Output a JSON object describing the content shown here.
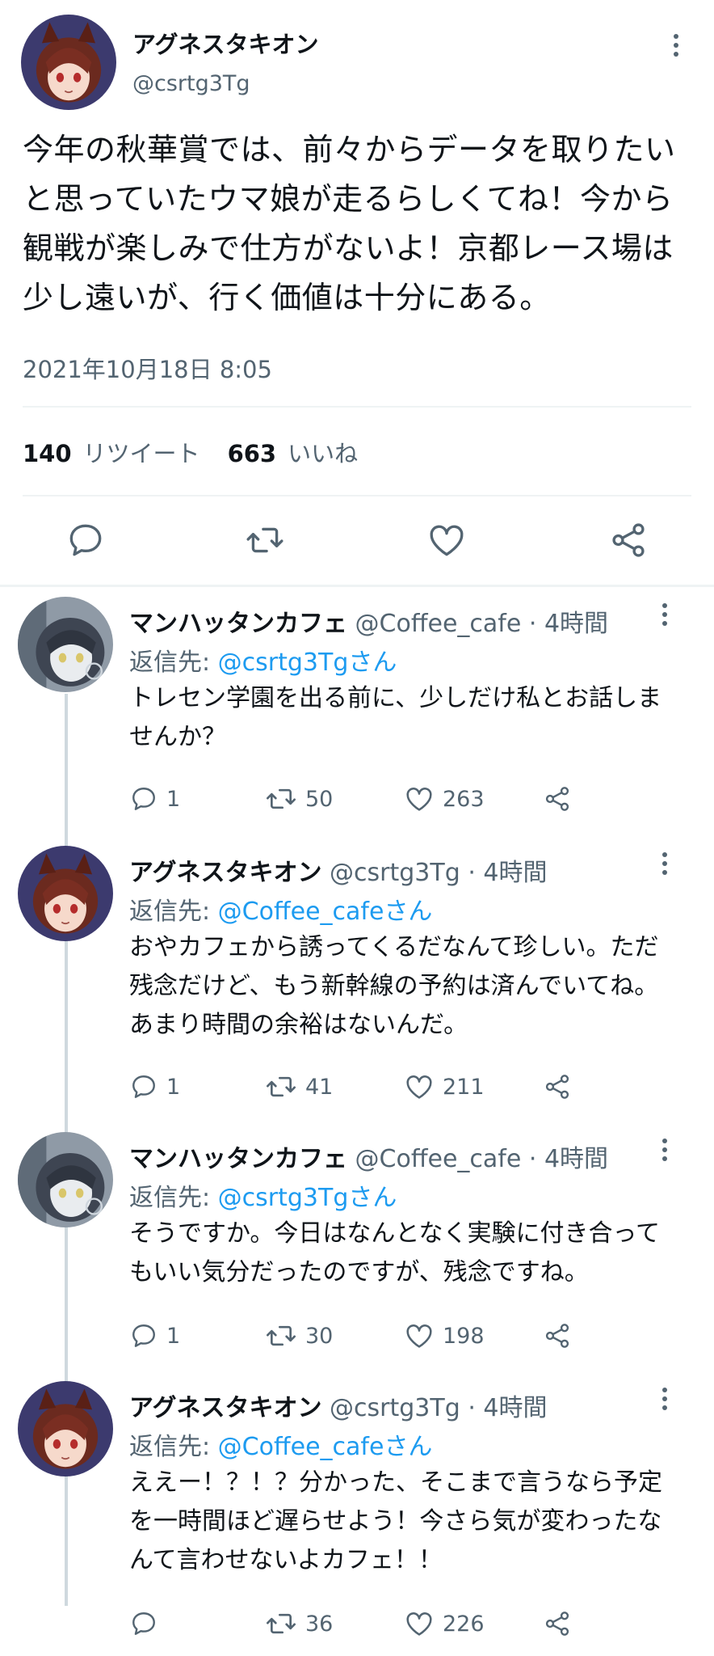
{
  "main_tweet": {
    "author_name": "アグネスタキオン",
    "author_handle": "@csrtg3Tg",
    "text": "今年の秋華賞では、前々からデータを取りたいと思っていたウマ娘が走るらしくてね！今から観戦が楽しみで仕方がないよ！京都レース場は少し遠いが、行く価値は十分にある。",
    "timestamp": "2021年10月18日 8:05",
    "retweet_count": "140",
    "retweet_label": "リツイート",
    "like_count": "663",
    "like_label": "いいね"
  },
  "replies": [
    {
      "name": "マンハッタンカフェ",
      "handle": "@Coffee_cafe",
      "separator": "·",
      "time": "4時間",
      "replying_to_label": "返信先:",
      "replying_to": "@csrtg3Tgさん",
      "text": "トレセン学園を出る前に、少しだけ私とお話しませんか？",
      "reply_count": "1",
      "retweet_count": "50",
      "like_count": "263"
    },
    {
      "name": "アグネスタキオン",
      "handle": "@csrtg3Tg",
      "separator": "·",
      "time": "4時間",
      "replying_to_label": "返信先:",
      "replying_to": "@Coffee_cafeさん",
      "text": "おやカフェから誘ってくるだなんて珍しい。ただ残念だけど、もう新幹線の予約は済んでいてね。あまり時間の余裕はないんだ。",
      "reply_count": "1",
      "retweet_count": "41",
      "like_count": "211"
    },
    {
      "name": "マンハッタンカフェ",
      "handle": "@Coffee_cafe",
      "separator": "·",
      "time": "4時間",
      "replying_to_label": "返信先:",
      "replying_to": "@csrtg3Tgさん",
      "text": "そうですか。今日はなんとなく実験に付き合ってもいい気分だったのですが、残念ですね。",
      "reply_count": "1",
      "retweet_count": "30",
      "like_count": "198"
    },
    {
      "name": "アグネスタキオン",
      "handle": "@csrtg3Tg",
      "separator": "·",
      "time": "4時間",
      "replying_to_label": "返信先:",
      "replying_to": "@Coffee_cafeさん",
      "text": "ええー！？！？分かった、そこまで言うなら予定を一時間ほど遅らせよう！今さら気が変わったなんて言わせないよカフェ！！",
      "reply_count": "",
      "retweet_count": "36",
      "like_count": "226"
    }
  ],
  "colors": {
    "text": "#0f1419",
    "secondary": "#536471",
    "link": "#1d9bf0",
    "divider": "#eff3f4",
    "thread_line": "#cfd9de"
  },
  "icons": [
    "more-icon",
    "reply-icon",
    "retweet-icon",
    "like-icon",
    "share-icon"
  ]
}
